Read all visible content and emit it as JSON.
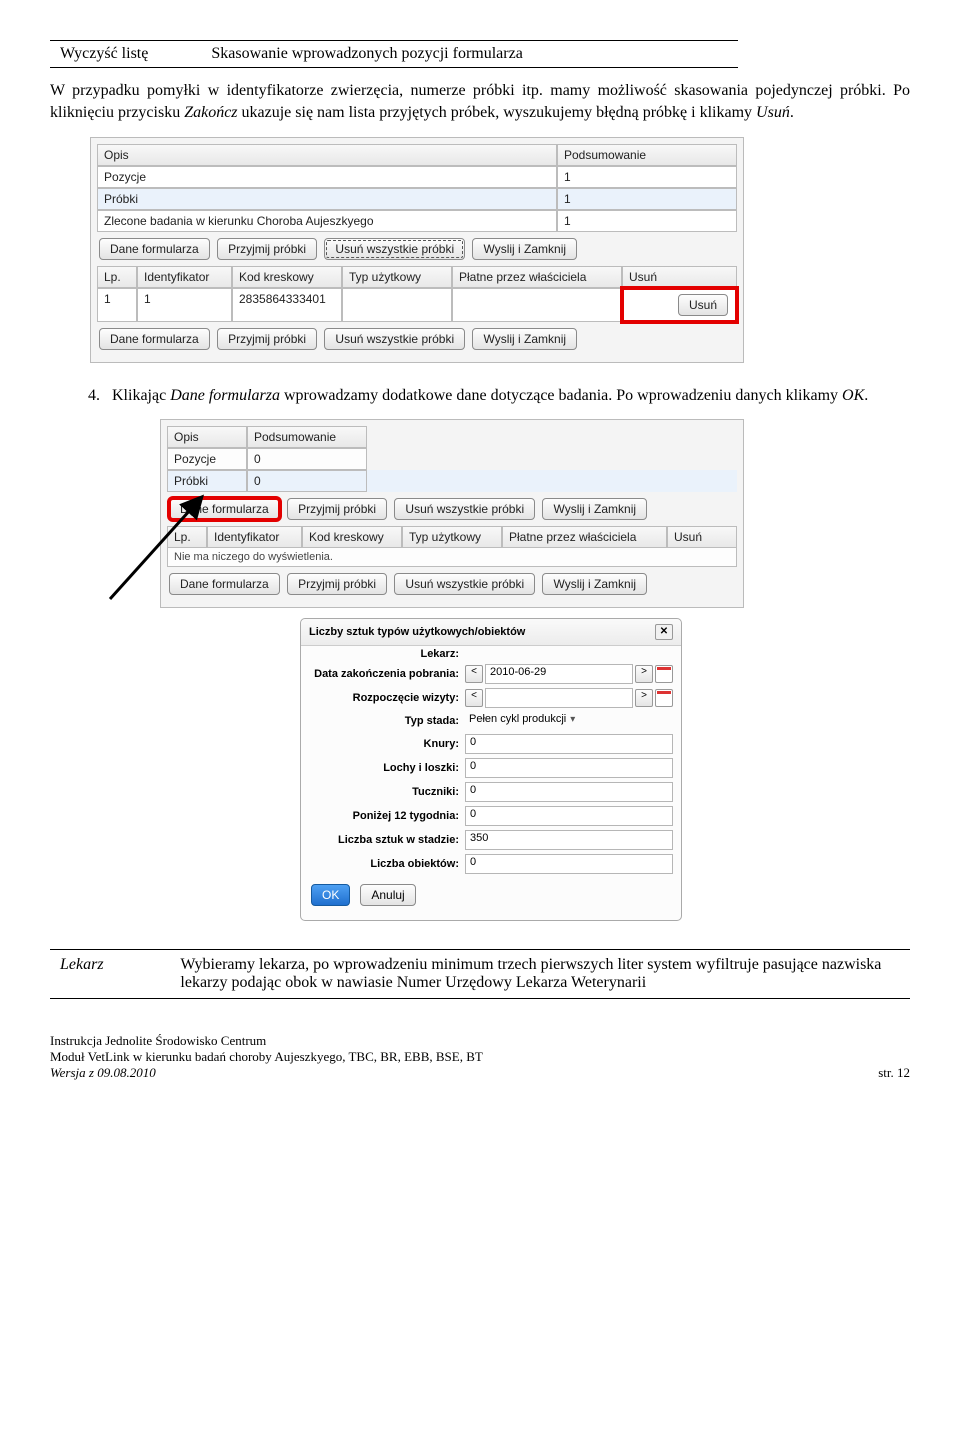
{
  "topTable": {
    "left": "Wyczyść listę",
    "right": "Skasowanie wprowadzonych pozycji formularza"
  },
  "para1_a": "W przypadku pomyłki w identyfikatorze zwierzęcia, numerze próbki itp. mamy możliwość skasowania pojedynczej próbki. Po kliknięciu przycisku ",
  "para1_b": "Zakończ",
  "para1_c": " ukazuje się nam lista przyjętych próbek, wyszukujemy błędną próbkę i klikamy ",
  "para1_d": "Usuń",
  "para1_e": ".",
  "shot1": {
    "h_opis": "Opis",
    "h_pod": "Podsumowanie",
    "r1a": "Pozycje",
    "r1b": "1",
    "r2a": "Próbki",
    "r2b": "1",
    "r3a": "Zlecone badania w kierunku Choroba Aujeszkyego",
    "r3b": "1",
    "btn_dane": "Dane formularza",
    "btn_przyj": "Przyjmij próbki",
    "btn_usunall": "Usuń wszystkie próbki",
    "btn_wyslij": "Wyslij i Zamknij",
    "g_lp": "Lp.",
    "g_id": "Identyfikator",
    "g_kod": "Kod kreskowy",
    "g_typ": "Typ użytkowy",
    "g_pl": "Płatne przez właściciela",
    "g_us": "Usuń",
    "d_lp": "1",
    "d_id": "1",
    "d_kod": "2835864333401",
    "btn_usun": "Usuń"
  },
  "item4_a": "Klikając ",
  "item4_b": "Dane formularza",
  "item4_c": " wprowadzamy dodatkowe dane dotyczące badania. Po wprowadzeniu danych klikamy ",
  "item4_d": "OK",
  "item4_e": ".",
  "shot2": {
    "h_opis": "Opis",
    "h_pod": "Podsumowanie",
    "r1a": "Pozycje",
    "r1b": "0",
    "r2a": "Próbki",
    "r2b": "0",
    "btn_dane": "Dane formularza",
    "btn_przyj": "Przyjmij próbki",
    "btn_usunall": "Usuń wszystkie próbki",
    "btn_wyslij": "Wyslij i Zamknij",
    "g_lp": "Lp.",
    "g_id": "Identyfikator",
    "g_kod": "Kod kreskowy",
    "g_typ": "Typ użytkowy",
    "g_pl": "Płatne przez właściciela",
    "g_us": "Usuń",
    "empty": "Nie ma niczego do wyświetlenia."
  },
  "dialog": {
    "title": "Liczby sztuk typów użytkowych/obiektów",
    "lekarz": "Lekarz:",
    "data_zak": "Data zakończenia pobrania:",
    "data_val": "2010-06-29",
    "rozp": "Rozpoczęcie wizyty:",
    "typ": "Typ stada:",
    "typ_val": "Pełen cykl produkcji",
    "knury": "Knury:",
    "knury_v": "0",
    "lochy": "Lochy i loszki:",
    "lochy_v": "0",
    "tucz": "Tuczniki:",
    "tucz_v": "0",
    "pon": "Poniżej 12 tygodnia:",
    "pon_v": "0",
    "liczba_st": "Liczba sztuk w stadzie:",
    "liczba_st_v": "350",
    "liczba_ob": "Liczba obiektów:",
    "liczba_ob_v": "0",
    "ok": "OK",
    "anuluj": "Anuluj",
    "lt": "<",
    "gt": ">"
  },
  "bottom": {
    "left": "Lekarz",
    "right": "Wybieramy lekarza, po wprowadzeniu minimum trzech pierwszych liter system wyfiltruje pasujące nazwiska lekarzy podając obok w nawiasie Numer Urzędowy Lekarza Weterynarii"
  },
  "footer": {
    "l1": "Instrukcja Jednolite Środowisko Centrum",
    "l2": "Moduł VetLink w kierunku badań choroby Aujeszkyego, TBC, BR, EBB, BSE, BT",
    "l3": "Wersja z 09.08.2010",
    "page": "str. 12"
  }
}
